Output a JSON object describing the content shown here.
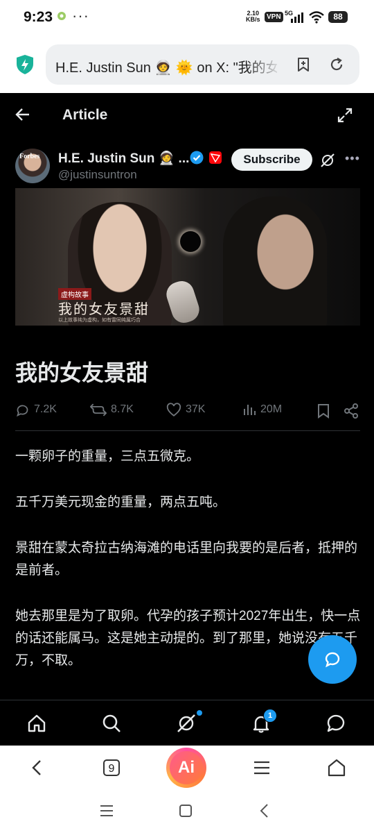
{
  "status_bar": {
    "time": "9:23",
    "dots": "···",
    "net_speed_value": "2.10",
    "net_speed_unit": "KB/s",
    "vpn": "VPN",
    "network": "5G",
    "battery": "88"
  },
  "browser": {
    "url_text": "H.E. Justin Sun 🧑‍🚀 🌞 on X: \"我的女",
    "tabs_count": "9",
    "ai_label": "Ai"
  },
  "header": {
    "title": "Article"
  },
  "author": {
    "name": "H.E. Justin Sun 🧑‍🚀 ...",
    "handle": "@justinsuntron",
    "avatar_text": "Forbes",
    "subscribe_label": "Subscribe"
  },
  "hero": {
    "badge": "虚构故事",
    "title": "我的女友景甜",
    "subtitle": "以上故事纯为虚构，如有雷同纯属巧合"
  },
  "article": {
    "title": "我的女友景甜",
    "paragraphs": [
      "一颗卵子的重量，三点五微克。",
      "五千万美元现金的重量，两点五吨。",
      "景甜在蒙太奇拉古纳海滩的电话里向我要的是后者，抵押的是前者。",
      "她去那里是为了取卵。代孕的孩子预计2027年出生，快一点的话还能属马。这是她主动提的。到了那里，她说没有五千万，不取。"
    ]
  },
  "actions": {
    "replies": "7.2K",
    "reposts": "8.7K",
    "likes": "37K",
    "views": "20M"
  },
  "tabbar": {
    "notifications_badge": "1"
  },
  "colors": {
    "accent": "#1d9bf0",
    "background": "#000000",
    "secondary_text": "#71767b"
  }
}
